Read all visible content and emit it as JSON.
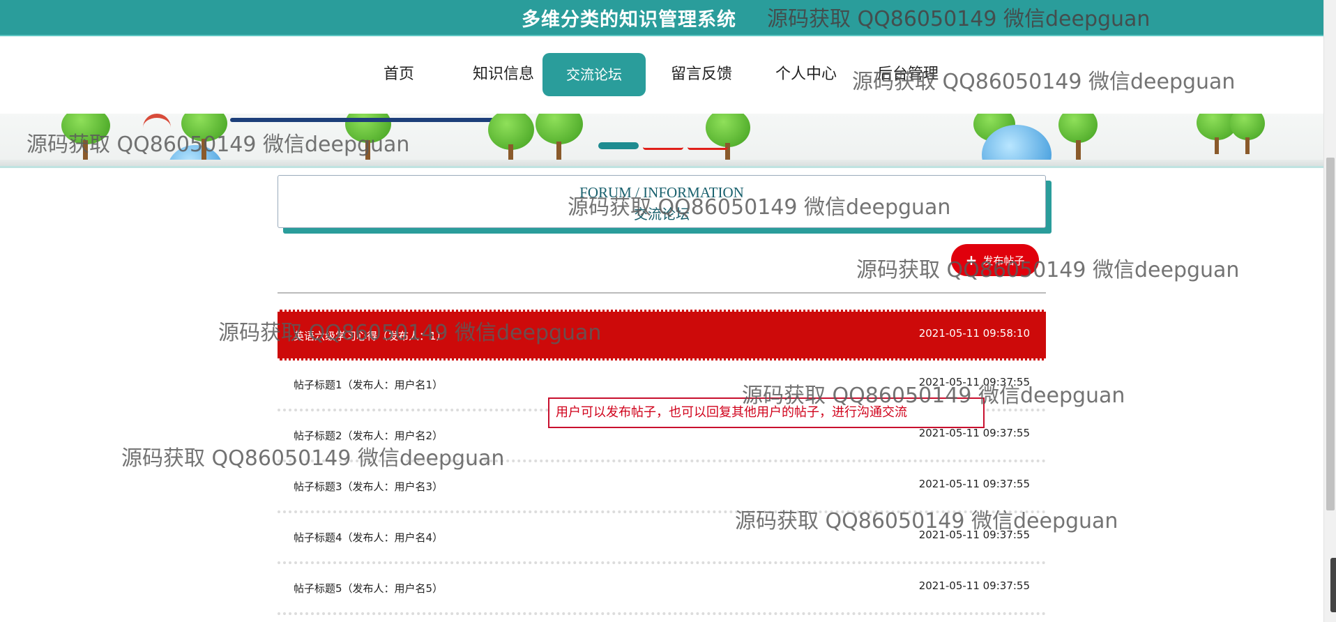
{
  "header": {
    "system_title": "多维分类的知识管理系统"
  },
  "nav": {
    "items": [
      "首页",
      "知识信息",
      "交流论坛",
      "留言反馈",
      "个人中心",
      "后台管理"
    ],
    "active": "交流论坛"
  },
  "forum": {
    "heading_en": "FORUM / INFORMATION",
    "heading_cn": "交流论坛",
    "publish_label": "发布帖子",
    "posts": [
      {
        "title": "英语六级学习心得（发布人：1）",
        "time": "2021-05-11 09:58:10"
      },
      {
        "title": "帖子标题1（发布人：用户名1）",
        "time": "2021-05-11 09:37:55"
      },
      {
        "title": "帖子标题2（发布人：用户名2）",
        "time": "2021-05-11 09:37:55"
      },
      {
        "title": "帖子标题3（发布人：用户名3）",
        "time": "2021-05-11 09:37:55"
      },
      {
        "title": "帖子标题4（发布人：用户名4）",
        "time": "2021-05-11 09:37:55"
      },
      {
        "title": "帖子标题5（发布人：用户名5）",
        "time": "2021-05-11 09:37:55"
      }
    ]
  },
  "annotation": {
    "text": "用户可以发布帖子，也可以回复其他用户的帖子，进行沟通交流"
  },
  "watermark": {
    "text": "源码获取 QQ86050149 微信deepguan"
  },
  "colors": {
    "teal": "#2a9d9b",
    "highlight_red": "#cd0a0a",
    "button_red": "#e0000c"
  }
}
